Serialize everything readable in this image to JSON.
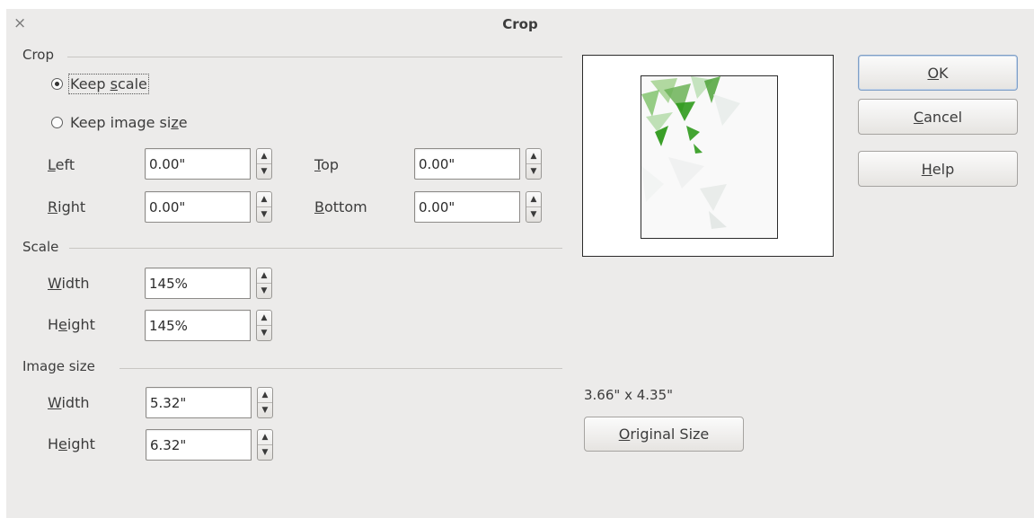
{
  "window": {
    "title": "Crop",
    "close_glyph": "×"
  },
  "crop": {
    "section_title": "Crop",
    "keep_scale": {
      "pre": "Keep ",
      "key": "s",
      "post": "cale",
      "selected": true
    },
    "keep_image_size": {
      "pre": "Keep image si",
      "key": "z",
      "post": "e",
      "selected": false
    },
    "left": {
      "key": "L",
      "rest": "eft",
      "value": "0.00\""
    },
    "right": {
      "key": "R",
      "rest": "ight",
      "value": "0.00\""
    },
    "top": {
      "key": "T",
      "rest": "op",
      "value": "0.00\""
    },
    "bottom": {
      "key": "B",
      "rest": "ottom",
      "value": "0.00\""
    }
  },
  "scale": {
    "section_title": "Scale",
    "width": {
      "key": "W",
      "rest": "idth",
      "value": "145%"
    },
    "height": {
      "pre": "H",
      "key": "e",
      "rest": "ight",
      "value": "145%"
    }
  },
  "image_size": {
    "section_title": "Image size",
    "width": {
      "key": "W",
      "rest": "idth",
      "value": "5.32\""
    },
    "height": {
      "pre": "H",
      "key": "e",
      "rest": "ight",
      "value": "6.32\""
    },
    "original_dimensions": "3.66\" x 4.35\"",
    "original_size_button": {
      "key": "O",
      "rest": "riginal Size"
    }
  },
  "buttons": {
    "ok": {
      "key": "O",
      "rest": "K"
    },
    "cancel": {
      "key": "C",
      "rest": "ancel"
    },
    "help": {
      "key": "H",
      "rest": "elp"
    }
  },
  "spin_glyphs": {
    "up": "▲",
    "down": "▼"
  },
  "colors": {
    "dialog_bg": "#ecebea",
    "leaf_dark": "#2f9a1c",
    "leaf_light": "#9fcf8a"
  }
}
